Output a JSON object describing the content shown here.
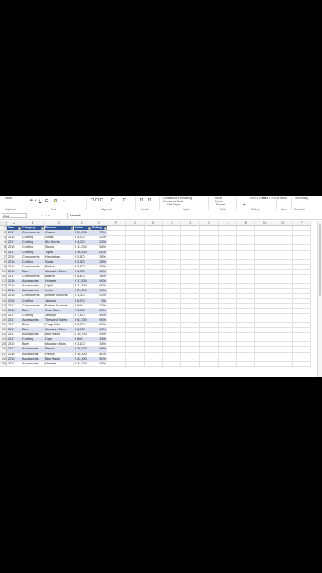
{
  "ribbon": {
    "top_labels": [
      "Paste",
      "Conditional Formatting",
      "Format as Table",
      "Cell Styles",
      "Insert",
      "Delete",
      "Format",
      "Sort & Filter",
      "Find & Select",
      "Ideas",
      "Sensitivity"
    ],
    "groups": [
      "Clipboard",
      "Font",
      "Alignment",
      "Number",
      "Styles",
      "Cells",
      "Editing",
      "Ideas",
      "Sensitivity"
    ]
  },
  "formula_bar": {
    "name_box": "C34",
    "fx": "fx",
    "content": "Helmets"
  },
  "columns": [
    "A",
    "B",
    "C",
    "D",
    "E",
    "F",
    "G",
    "H",
    "I",
    "J",
    "K",
    "L",
    "M",
    "N",
    "O",
    "P"
  ],
  "table": {
    "headers": [
      "Year",
      "Category",
      "Product",
      "Sales",
      "Rating"
    ],
    "rows": [
      [
        "2017",
        "Components",
        "Chains",
        "$ 20,000",
        "75%"
      ],
      [
        "2015",
        "Clothing",
        "Socks",
        "$ 3,700",
        "22%"
      ],
      [
        "2017",
        "Clothing",
        "Bib-Shorts",
        "$ 4,000",
        "22%"
      ],
      [
        "2015",
        "Clothing",
        "Shorts",
        "$ 13,300",
        "56%"
      ],
      [
        "2017",
        "Clothing",
        "Tights",
        "$ 36,800",
        "100%"
      ],
      [
        "2015",
        "Components",
        "Handlebars",
        "$ 2,300",
        "35%"
      ],
      [
        "2016",
        "Clothing",
        "Socks",
        "$ 2,300",
        "28%"
      ],
      [
        "2016",
        "Components",
        "Brakes",
        "$ 3,400",
        "36%"
      ],
      [
        "2016",
        "Bikes",
        "Mountain Bikes",
        "$ 6,300",
        "40%"
      ],
      [
        "2017",
        "Components",
        "Brakes",
        "$ 5,400",
        "38%"
      ],
      [
        "2016",
        "Accessories",
        "Helmets",
        "$ 17,600",
        "90%"
      ],
      [
        "2016",
        "Accessories",
        "Lights",
        "$ 21,600",
        "90%"
      ],
      [
        "2016",
        "Accessories",
        "Locks",
        "$ 29,800",
        "90%"
      ],
      [
        "2016",
        "Components",
        "Bottom Brackets",
        "$ 1,000",
        "23%"
      ],
      [
        "2015",
        "Clothing",
        "Jerseys",
        "$ 6,700",
        "5%"
      ],
      [
        "2017",
        "Components",
        "Bottom Brackets",
        "$ 600",
        "27%"
      ],
      [
        "2015",
        "Bikes",
        "Road Bikes",
        "$ 3,500",
        "50%"
      ],
      [
        "2017",
        "Clothing",
        "Jerseys",
        "$ 7,500",
        "46%"
      ],
      [
        "2017",
        "Accessories",
        "Tires and Tubes",
        "$ 63,700",
        "90%"
      ],
      [
        "2017",
        "Bikes",
        "Cargo Bike",
        "$ 9,200",
        "60%"
      ],
      [
        "2017",
        "Bikes",
        "Mountain Bikes",
        "$ 8,500",
        "66%"
      ],
      [
        "2017",
        "Accessories",
        "Bike Racks",
        "$ 10,700",
        "91%"
      ],
      [
        "2017",
        "Clothing",
        "Caps",
        "$ 600",
        "15%"
      ],
      [
        "2015",
        "Bikes",
        "Mountain Bikes",
        "$ 3,100",
        "35%"
      ],
      [
        "2017",
        "Accessories",
        "Pumps",
        "$ 30,700",
        "95%"
      ],
      [
        "2016",
        "Accessories",
        "Pumps",
        "$ 16,400",
        "80%"
      ],
      [
        "2015",
        "Accessories",
        "Bike Racks",
        "$ 22,100",
        "90%"
      ],
      [
        "2017",
        "Accessories",
        "Helmets",
        "$ 34,000",
        "95%"
      ]
    ]
  },
  "colors": {
    "header_bg": "#2f5597",
    "band_bg": "#d9e1f2"
  }
}
